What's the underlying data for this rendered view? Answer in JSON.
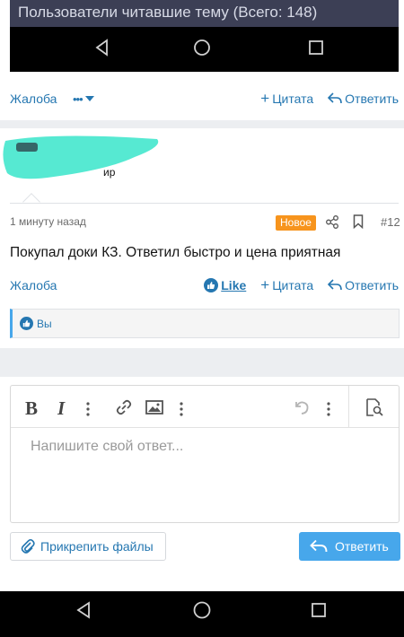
{
  "embedded_screenshot": {
    "header_text": "Пользователи читавшие тему (Всего: 148)"
  },
  "post1_actions": {
    "report": "Жалоба",
    "more": "•••",
    "quote": "Цитата",
    "reply": "Ответить"
  },
  "post2": {
    "username_fragment": "ир",
    "time": "1 минуту назад",
    "badge": "Новое",
    "number": "#12",
    "body": "Покупал доки КЗ. Ответил быстро и цена приятная",
    "report": "Жалоба",
    "like": "Like",
    "quote": "Цитата",
    "reply": "Ответить",
    "reactions_user": "Вы"
  },
  "editor": {
    "placeholder": "Напишите свой ответ..."
  },
  "buttons": {
    "attach": "Прикрепить файлы",
    "reply": "Ответить"
  },
  "colors": {
    "link": "#2577b1",
    "accent": "#47a7eb",
    "badge": "#f7941d",
    "scribble": "#4de8d0"
  },
  "icons": [
    "back-icon",
    "home-icon",
    "recents-icon",
    "reply-icon",
    "share-icon",
    "bookmark-icon",
    "like-icon",
    "bold-icon",
    "italic-icon",
    "link-icon",
    "image-icon",
    "undo-icon",
    "preview-icon",
    "paperclip-icon"
  ]
}
